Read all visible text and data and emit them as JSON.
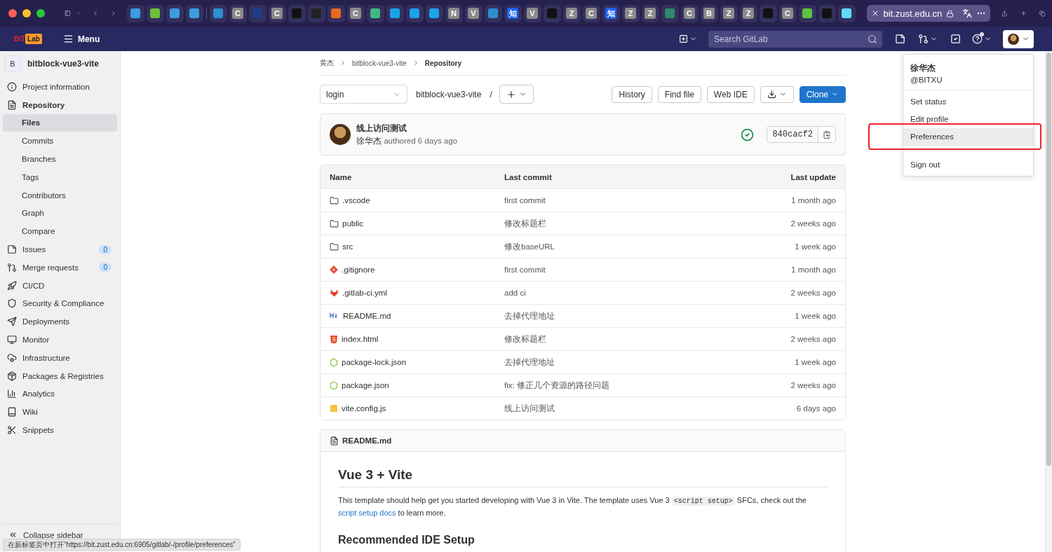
{
  "browser": {
    "tabs": [
      {
        "kind": "favicon",
        "color": "#3d9be0"
      },
      {
        "kind": "favicon",
        "color": "#6cbf3a"
      },
      {
        "kind": "favicon",
        "color": "#3d9be0"
      },
      {
        "kind": "favicon",
        "color": "#3d9be0"
      },
      {
        "kind": "divider"
      },
      {
        "kind": "favicon",
        "color": "#2d8fcf"
      },
      {
        "kind": "letter",
        "text": "C",
        "color": "#8a8a8a"
      },
      {
        "kind": "favicon",
        "color": "#1e3a8a"
      },
      {
        "kind": "letter",
        "text": "C",
        "color": "#8a8a8a"
      },
      {
        "kind": "favicon",
        "color": "#111111"
      },
      {
        "kind": "favicon",
        "color": "#222222"
      },
      {
        "kind": "favicon",
        "color": "#e8691c"
      },
      {
        "kind": "letter",
        "text": "C",
        "color": "#8a8a8a"
      },
      {
        "kind": "favicon",
        "color": "#41b883"
      },
      {
        "kind": "favicon",
        "color": "#1aa3e8"
      },
      {
        "kind": "favicon",
        "color": "#1aa3e8"
      },
      {
        "kind": "favicon",
        "color": "#1aa3e8"
      },
      {
        "kind": "letter",
        "text": "N",
        "color": "#8a8a8a"
      },
      {
        "kind": "letter",
        "text": "V",
        "color": "#8a8a8a"
      },
      {
        "kind": "favicon",
        "color": "#2d8fcf"
      },
      {
        "kind": "letter",
        "text": "知",
        "color": "#1d63f0"
      },
      {
        "kind": "letter",
        "text": "V",
        "color": "#8a8a8a"
      },
      {
        "kind": "favicon",
        "color": "#111111"
      },
      {
        "kind": "letter",
        "text": "Z",
        "color": "#8a8a8a"
      },
      {
        "kind": "letter",
        "text": "C",
        "color": "#8a8a8a"
      },
      {
        "kind": "letter",
        "text": "知",
        "color": "#1d63f0"
      },
      {
        "kind": "letter",
        "text": "Z",
        "color": "#8a8a8a"
      },
      {
        "kind": "letter",
        "text": "Z",
        "color": "#8a8a8a"
      },
      {
        "kind": "favicon",
        "color": "#2f8a6a"
      },
      {
        "kind": "letter",
        "text": "C",
        "color": "#8a8a8a"
      },
      {
        "kind": "letter",
        "text": "B",
        "color": "#8a8a8a"
      },
      {
        "kind": "letter",
        "text": "Z",
        "color": "#8a8a8a"
      },
      {
        "kind": "letter",
        "text": "Z",
        "color": "#8a8a8a"
      },
      {
        "kind": "favicon",
        "color": "#111111"
      },
      {
        "kind": "letter",
        "text": "C",
        "color": "#8a8a8a"
      },
      {
        "kind": "favicon",
        "color": "#5cc242"
      },
      {
        "kind": "favicon",
        "color": "#111111"
      },
      {
        "kind": "favicon",
        "color": "#61dafb"
      }
    ],
    "address": "bit.zust.edu.cn"
  },
  "header": {
    "logo_red": "BIT",
    "logo_box": "Lab",
    "menu": "Menu",
    "search": {
      "placeholder": "Search GitLab"
    }
  },
  "sidebar": {
    "project": {
      "initial": "B",
      "name": "bitblock-vue3-vite"
    },
    "items": [
      {
        "label": "Project information",
        "selected": false
      },
      {
        "label": "Repository",
        "selected": false,
        "expanded": true,
        "children": [
          {
            "label": "Files",
            "selected": true
          },
          {
            "label": "Commits",
            "selected": false
          },
          {
            "label": "Branches",
            "selected": false
          },
          {
            "label": "Tags",
            "selected": false
          },
          {
            "label": "Contributors",
            "selected": false
          },
          {
            "label": "Graph",
            "selected": false
          },
          {
            "label": "Compare",
            "selected": false
          }
        ]
      },
      {
        "label": "Issues",
        "selected": false,
        "badge": "0"
      },
      {
        "label": "Merge requests",
        "selected": false,
        "badge": "0"
      },
      {
        "label": "CI/CD",
        "selected": false
      },
      {
        "label": "Security & Compliance",
        "selected": false
      },
      {
        "label": "Deployments",
        "selected": false
      },
      {
        "label": "Monitor",
        "selected": false
      },
      {
        "label": "Infrastructure",
        "selected": false
      },
      {
        "label": "Packages & Registries",
        "selected": false
      },
      {
        "label": "Analytics",
        "selected": false
      },
      {
        "label": "Wiki",
        "selected": false
      },
      {
        "label": "Snippets",
        "selected": false
      }
    ],
    "collapse": "Collapse sidebar"
  },
  "breadcrumb": [
    "黄杰",
    "bitblock-vue3-vite",
    "Repository"
  ],
  "toolbar": {
    "branch": "login",
    "path": "bitblock-vue3-vite",
    "separator": "/",
    "buttons": [
      "History",
      "Find file",
      "Web IDE"
    ],
    "clone": "Clone"
  },
  "commit": {
    "title": "线上访问测试",
    "author": "徐华杰",
    "meta": "authored 6 days ago",
    "sha": "840cacf2"
  },
  "table": {
    "columns": [
      "Name",
      "Last commit",
      "Last update"
    ],
    "rows": [
      {
        "kind": "folder",
        "name": ".vscode",
        "commit": "first commit",
        "updated": "1 month ago"
      },
      {
        "kind": "folder",
        "name": "public",
        "commit": "修改标题栏",
        "updated": "2 weeks ago"
      },
      {
        "kind": "folder",
        "name": "src",
        "commit": "修改baseURL",
        "updated": "1 week ago"
      },
      {
        "kind": "file",
        "name": ".gitignore",
        "commit": "first commit",
        "updated": "1 month ago"
      },
      {
        "kind": "file",
        "name": ".gitlab-ci.yml",
        "commit": "add ci",
        "updated": "2 weeks ago"
      },
      {
        "kind": "file",
        "name": "README.md",
        "commit": "去掉代理地址",
        "updated": "1 week ago"
      },
      {
        "kind": "file",
        "name": "index.html",
        "commit": "修改标题栏",
        "updated": "2 weeks ago"
      },
      {
        "kind": "file",
        "name": "package-lock.json",
        "commit": "去掉代理地址",
        "updated": "1 week ago"
      },
      {
        "kind": "file",
        "name": "package.json",
        "commit": "fix: 修正几个资源的路径问题",
        "updated": "2 weeks ago"
      },
      {
        "kind": "file",
        "name": "vite.config.js",
        "commit": "线上访问测试",
        "updated": "6 days ago"
      }
    ]
  },
  "readme": {
    "file": "README.md",
    "title": "Vue 3 + Vite",
    "paragraph": [
      {
        "kind": "text",
        "text": "This template should help get you started developing with Vue 3 in Vite. The template uses Vue 3 "
      },
      {
        "kind": "code",
        "text": "<script setup>"
      },
      {
        "kind": "text",
        "text": " SFCs, check out the "
      },
      {
        "kind": "link",
        "text": "script setup docs"
      },
      {
        "kind": "text",
        "text": " to learn more."
      }
    ],
    "subtitle": "Recommended IDE Setup"
  },
  "user_menu": {
    "name": "徐华杰",
    "handle": "@BITXU",
    "items": [
      {
        "label": "Set status",
        "selected": false
      },
      {
        "label": "Edit profile",
        "selected": false
      },
      {
        "label": "Preferences",
        "selected": true
      },
      {
        "label": "Sign out",
        "selected": false
      }
    ]
  },
  "status_tooltip": "在新标签页中打开“https://bit.zust.edu.cn:6905/gitlab/-/profile/preferences”"
}
